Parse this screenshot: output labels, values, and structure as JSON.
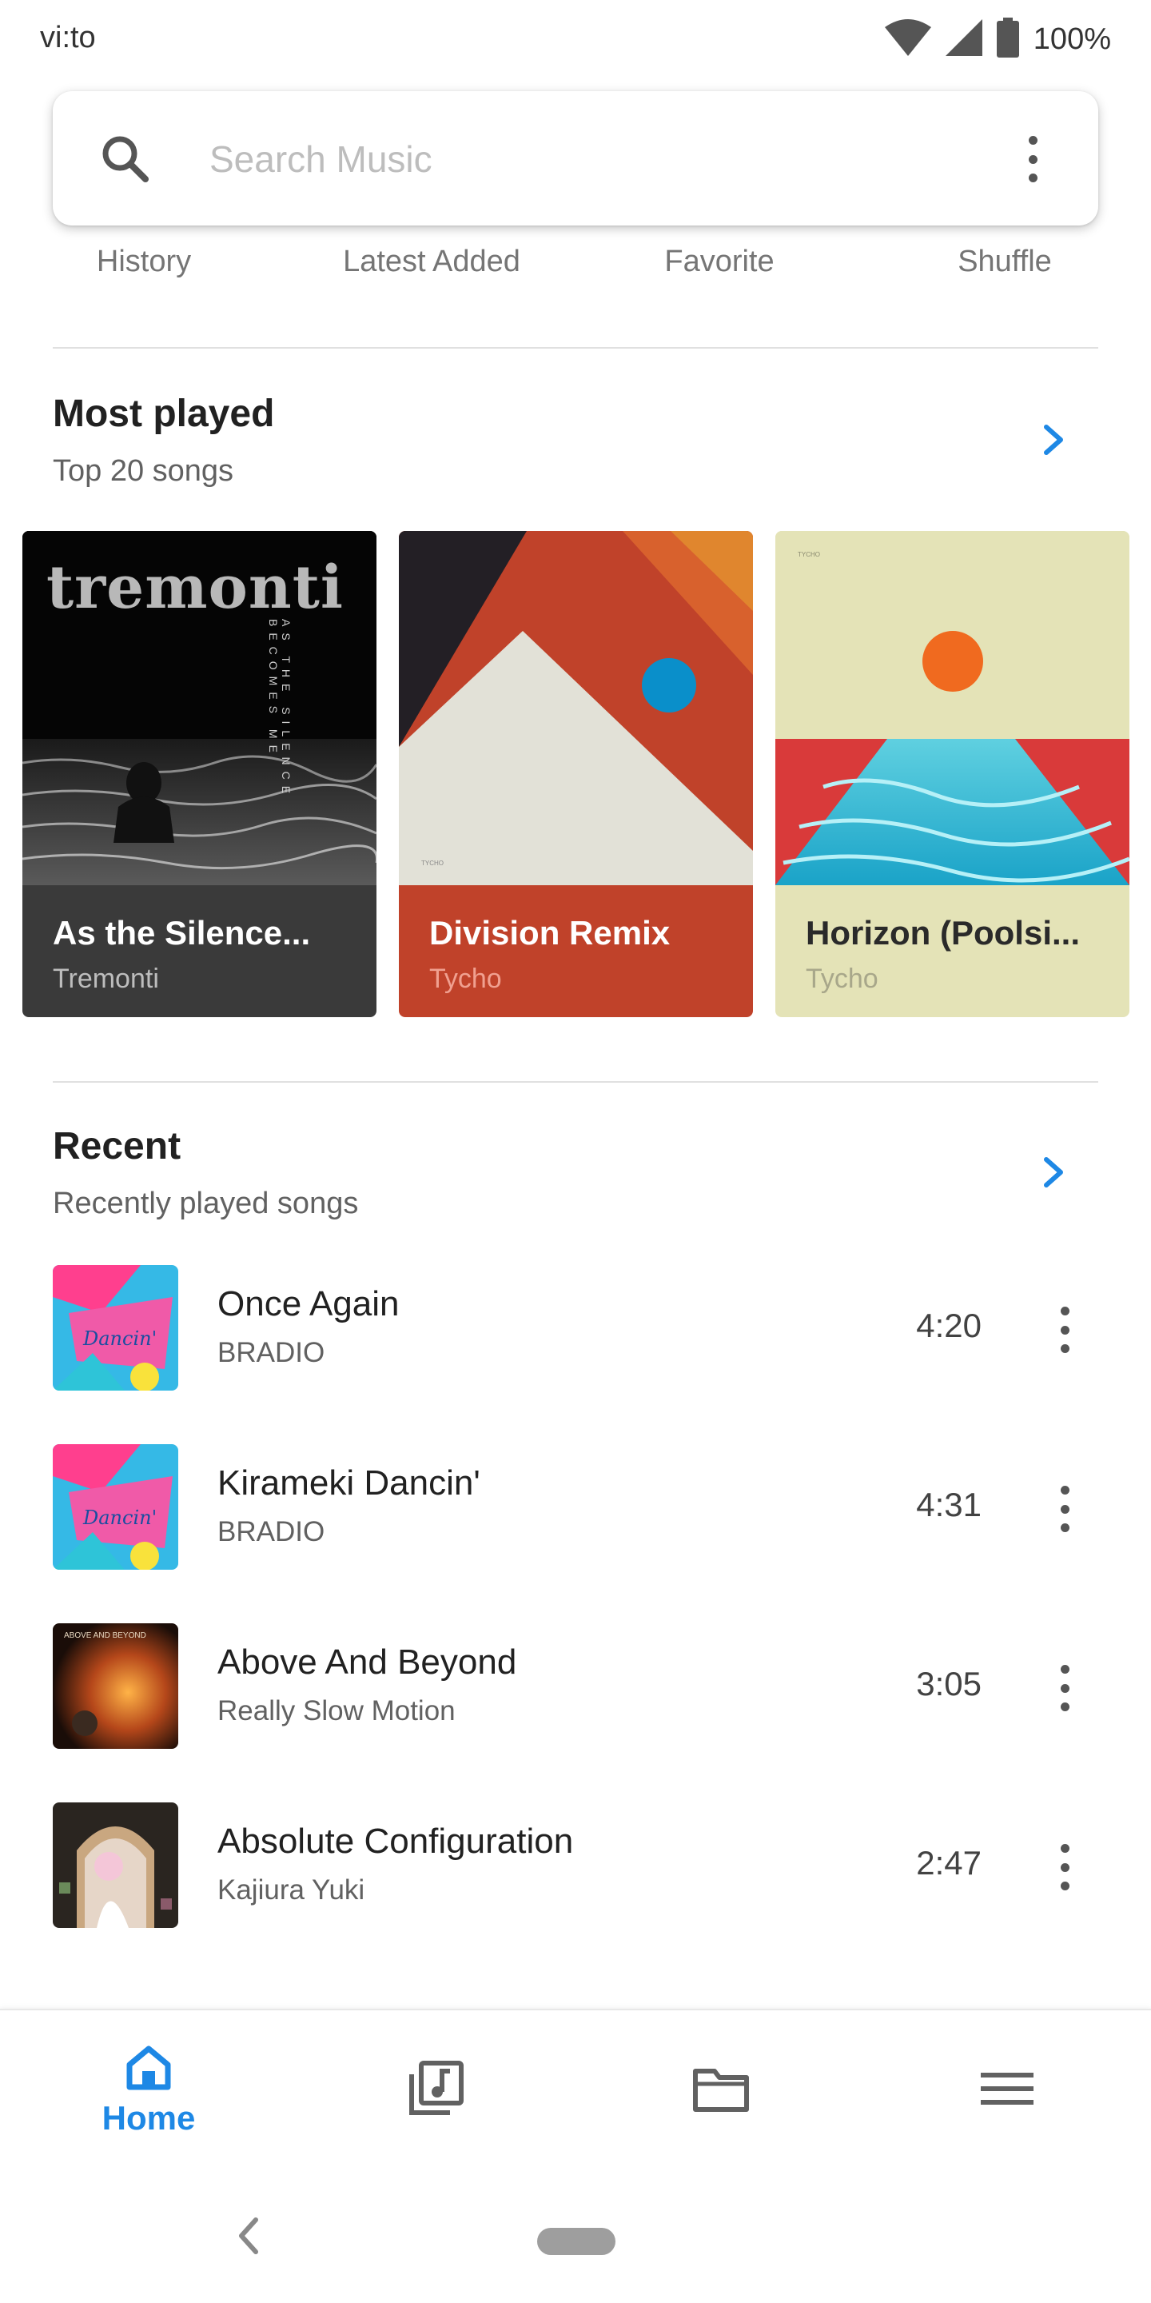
{
  "status_bar": {
    "carrier": "vi:to",
    "battery": "100%"
  },
  "search": {
    "placeholder": "Search Music",
    "value": ""
  },
  "quick_tabs": [
    "History",
    "Latest Added",
    "Favorite",
    "Shuffle"
  ],
  "most_played": {
    "title": "Most played",
    "subtitle": "Top 20 songs",
    "cards": [
      {
        "title": "As the Silence...",
        "artist": "Tremonti",
        "art_text": "tremonti",
        "art_side_text": "AS THE SILENCE BECOMES ME",
        "bg": "#3a3a3a",
        "title_color": "#ffffff",
        "artist_color": "#bdbdbd"
      },
      {
        "title": "Division Remix",
        "artist": "Tycho",
        "bg": "#c0422a",
        "title_color": "#ffffff",
        "artist_color": "#f0a090"
      },
      {
        "title": "Horizon (Poolsi...",
        "artist": "Tycho",
        "bg": "#e4e3b7",
        "title_color": "#2a2a2a",
        "artist_color": "#a8a78a"
      }
    ]
  },
  "recent": {
    "title": "Recent",
    "subtitle": "Recently played songs",
    "songs": [
      {
        "title": "Once Again",
        "artist": "BRADIO",
        "duration": "4:20"
      },
      {
        "title": "Kirameki Dancin'",
        "artist": "BRADIO",
        "duration": "4:31"
      },
      {
        "title": "Above And Beyond",
        "artist": "Really Slow Motion",
        "duration": "3:05"
      },
      {
        "title": "Absolute Configuration",
        "artist": "Kajiura Yuki",
        "duration": "2:47"
      }
    ]
  },
  "bottom_nav": {
    "home_label": "Home",
    "active": "home"
  },
  "colors": {
    "accent": "#1e88e5",
    "icon_gray": "#616161"
  }
}
